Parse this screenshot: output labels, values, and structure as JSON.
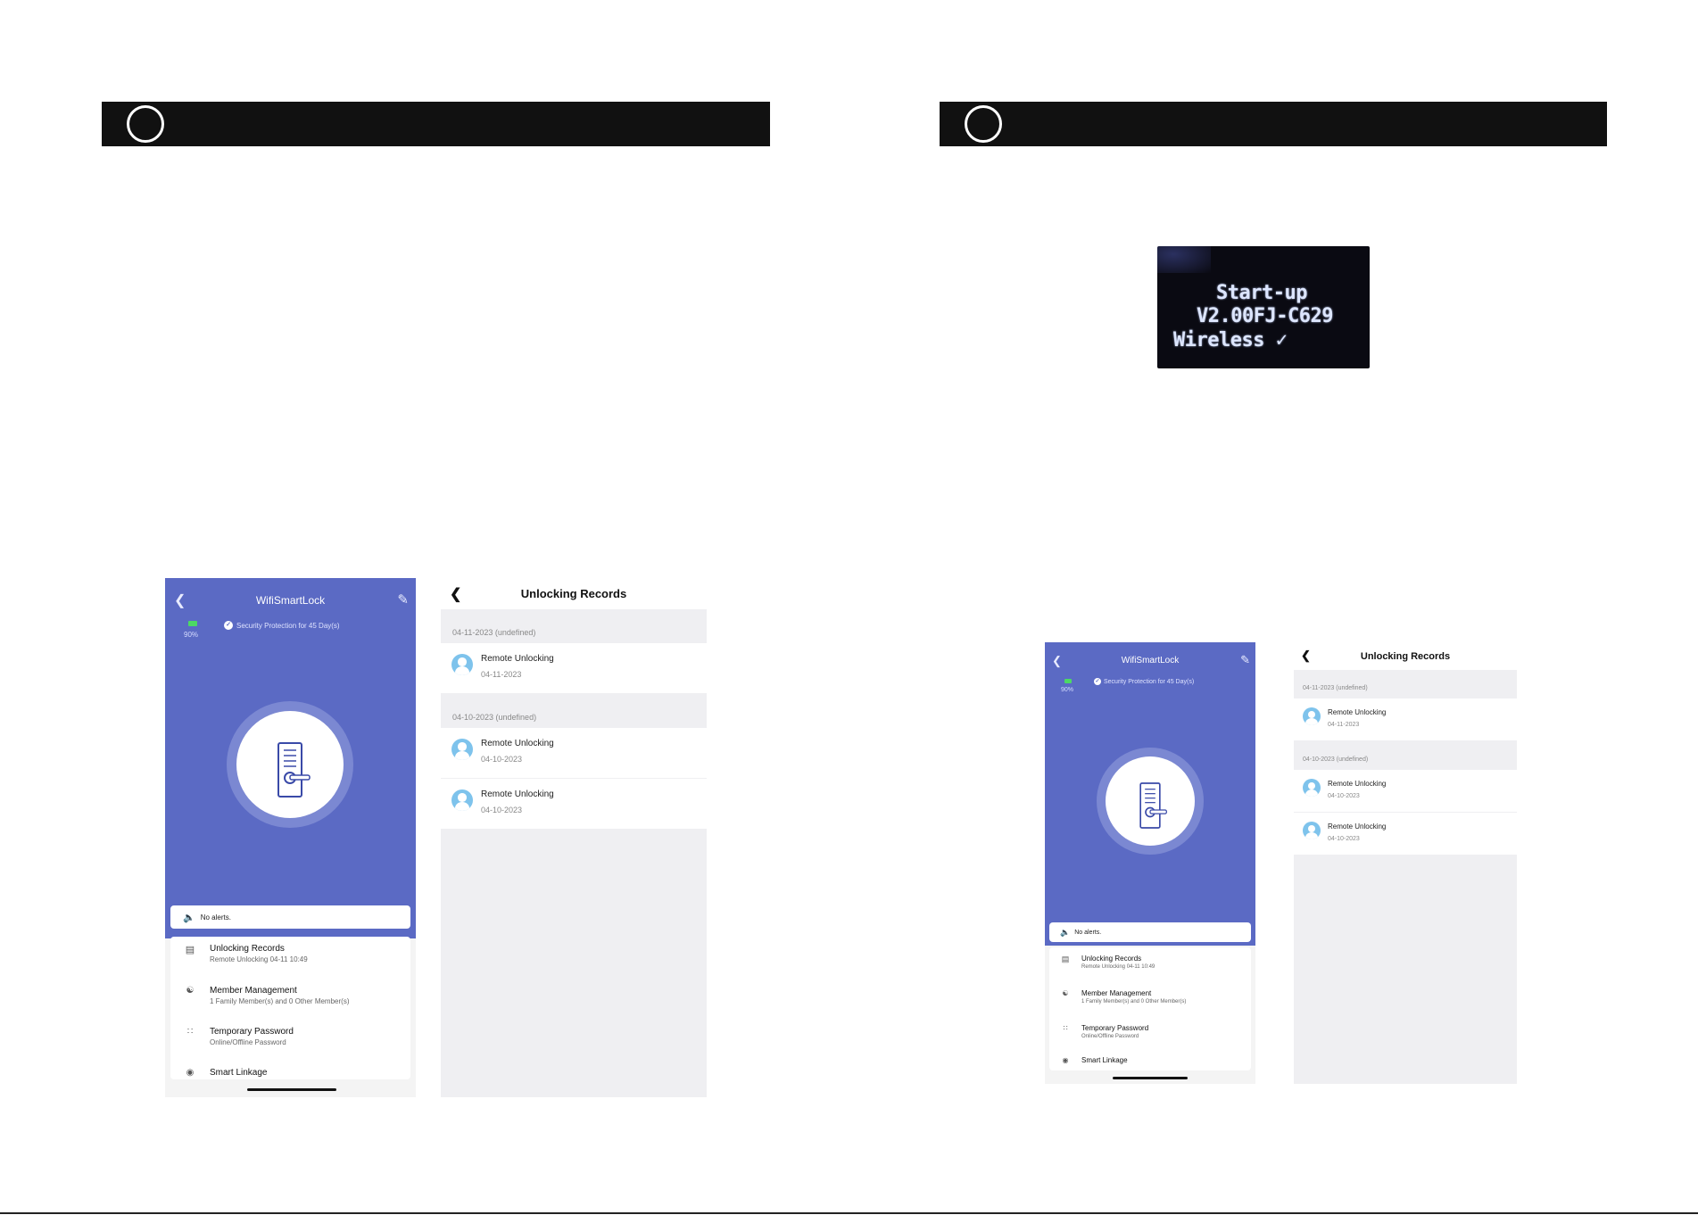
{
  "main_screen": {
    "title": "WifiSmartLock",
    "back_icon": "chevron-left-icon",
    "edit_icon": "pencil-icon",
    "battery_percent": "90%",
    "battery_level": 0.9,
    "security_text": "Security Protection for 45 Day(s)",
    "alerts_text": "No alerts.",
    "menu": [
      {
        "icon": "document-icon",
        "title": "Unlocking Records",
        "subtitle": "Remote Unlocking 04-11 10:49"
      },
      {
        "icon": "users-icon",
        "title": "Member Management",
        "subtitle": "1 Family Member(s) and 0 Other Member(s)"
      },
      {
        "icon": "keypad-icon",
        "title": "Temporary Password",
        "subtitle": "Online/Offline Password"
      },
      {
        "icon": "toggle-icon",
        "title": "Smart Linkage",
        "subtitle": ""
      }
    ],
    "colors": {
      "header": "#5b6ac4",
      "ring": "#7b88d2",
      "battery": "#4cd964"
    }
  },
  "records_screen": {
    "title": "Unlocking Records",
    "back_icon": "chevron-left-icon",
    "groups": [
      {
        "date": "04-11-2023 (undefined)",
        "items": [
          {
            "name": "Remote Unlocking",
            "time": "04-11-2023"
          }
        ]
      },
      {
        "date": "04-10-2023 (undefined)",
        "items": [
          {
            "name": "Remote Unlocking",
            "time": "04-10-2023"
          },
          {
            "name": "Remote Unlocking",
            "time": "04-10-2023"
          }
        ]
      }
    ]
  },
  "display": {
    "line1": "Start-up",
    "line2": "V2.00FJ-C629",
    "line3": "Wireless ✓"
  }
}
